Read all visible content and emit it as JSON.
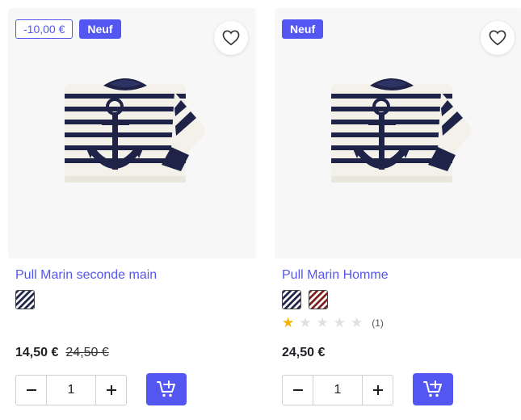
{
  "products": [
    {
      "discount_badge": "-10,00 €",
      "new_badge": "Neuf",
      "title": "Pull Marin seconde main",
      "price": "14,50 €",
      "old_price": "24,50 €",
      "quantity": "1",
      "swatches": [
        "navy-white-stripes"
      ]
    },
    {
      "new_badge": "Neuf",
      "title": "Pull Marin Homme",
      "price": "24,50 €",
      "quantity": "1",
      "rating": {
        "value": 1,
        "max": 5,
        "count_label": "(1)"
      },
      "swatches": [
        "navy-white-stripes",
        "red-white-stripes"
      ]
    }
  ],
  "icons": {
    "wishlist": "heart-icon",
    "decrement": "minus-icon",
    "increment": "plus-icon",
    "add_to_cart": "cart-plus-icon"
  },
  "colors": {
    "accent": "#5356f0",
    "stripe_navy": "#1e2347",
    "stripe_red": "#7a1e1e",
    "star_on": "#f5b400",
    "star_off": "#e0e0e0"
  }
}
